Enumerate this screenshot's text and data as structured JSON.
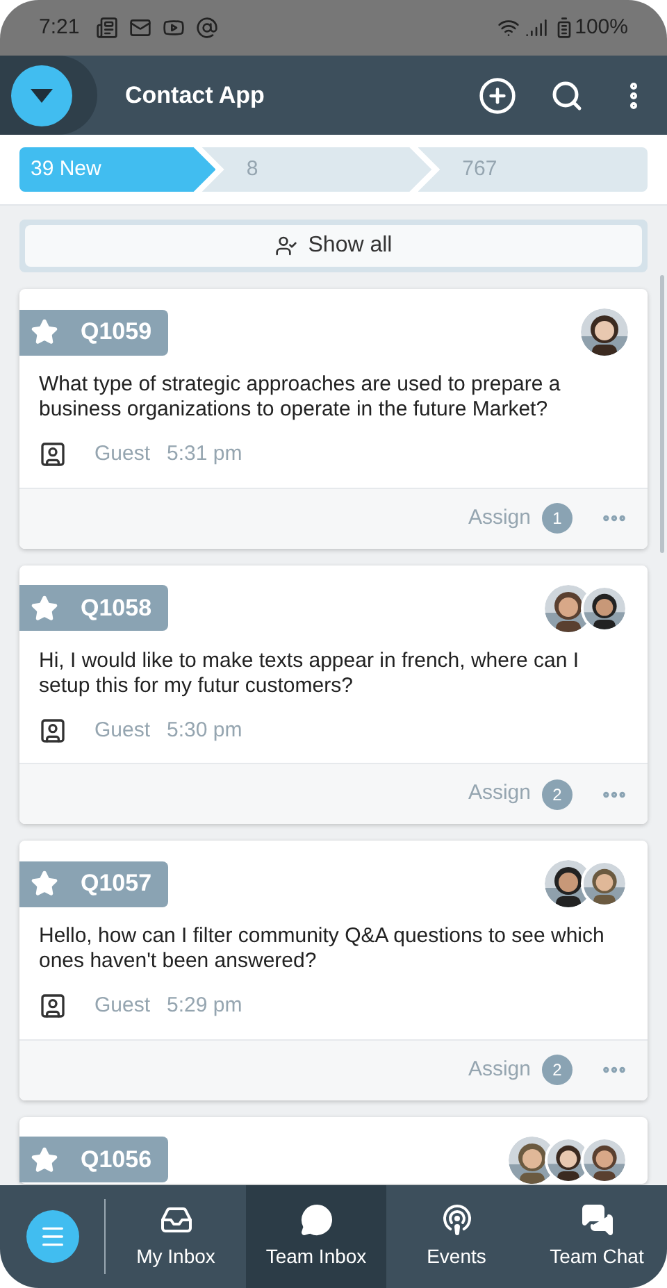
{
  "status_bar": {
    "time": "7:21",
    "battery": "100%"
  },
  "header": {
    "title": "Contact App"
  },
  "stages": [
    {
      "label": "39 New",
      "selected": true
    },
    {
      "label": "8",
      "selected": false
    },
    {
      "label": "767",
      "selected": false
    }
  ],
  "filter": {
    "label": "Show all"
  },
  "cards": [
    {
      "id": "Q1059",
      "text": "What type of strategic approaches are used to prepare a business organizations to operate in the future Market?",
      "author": "Guest",
      "time": "5:31 pm",
      "assign": "Assign",
      "assign_count": "1"
    },
    {
      "id": "Q1058",
      "text": "Hi, I would like to make texts appear in french, where can I setup this for my futur customers?",
      "author": "Guest",
      "time": "5:30 pm",
      "assign": "Assign",
      "assign_count": "2"
    },
    {
      "id": "Q1057",
      "text": "Hello, how can I filter community Q&A questions to see which ones haven't been answered?",
      "author": "Guest",
      "time": "5:29 pm",
      "assign": "Assign",
      "assign_count": "2"
    },
    {
      "id": "Q1056"
    }
  ],
  "bottom_nav": [
    {
      "kind": "inbox",
      "label": "My Inbox",
      "selected": false
    },
    {
      "kind": "chat",
      "label": "Team Inbox",
      "selected": true
    },
    {
      "kind": "events",
      "label": "Events",
      "selected": false
    },
    {
      "kind": "team",
      "label": "Team Chat",
      "selected": false
    }
  ]
}
